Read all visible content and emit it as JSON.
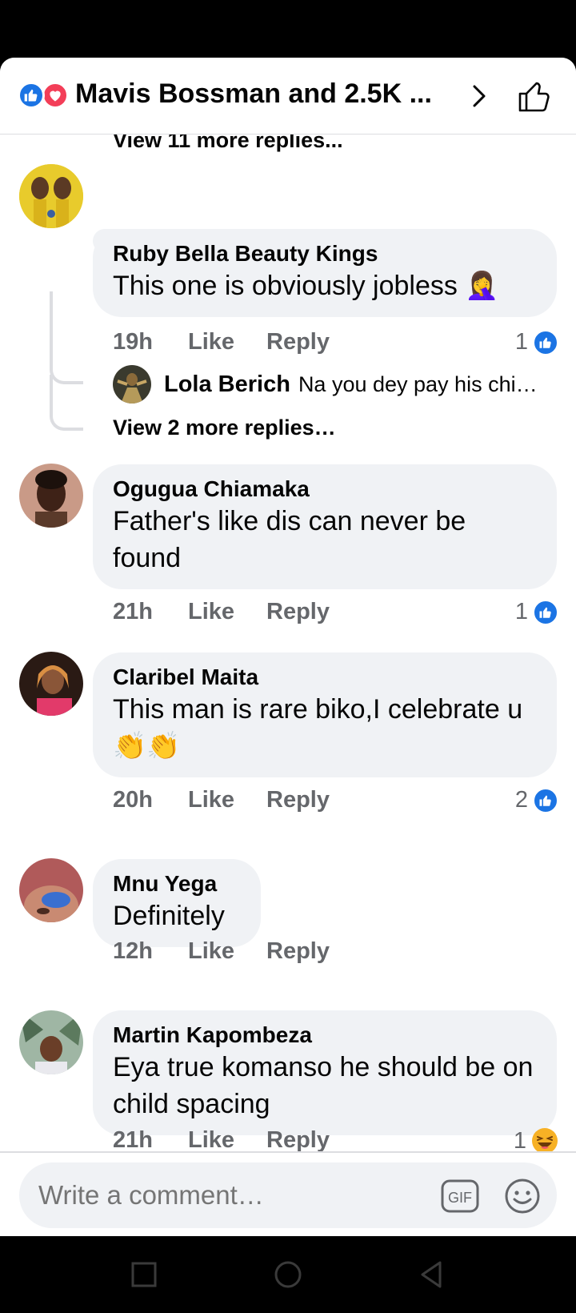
{
  "header": {
    "title": "Mavis Bossman and 2.5K ...",
    "colors": {
      "like": "#1b74e4",
      "love": "#f33e58"
    }
  },
  "cut_off_text": "View 11 more replies...",
  "comments": [
    {
      "author": "Ruby Bella Beauty Kings",
      "text": "This one is obviously jobless 🤦‍♀️",
      "time": "19h",
      "like": "Like",
      "reply": "Reply",
      "reaction_count": "1",
      "reaction_icon": "like-icon"
    },
    {
      "author": "Ogugua Chiamaka",
      "text": "Father's like dis can never be found",
      "time": "21h",
      "like": "Like",
      "reply": "Reply",
      "reaction_count": "1",
      "reaction_icon": "like-icon"
    },
    {
      "author": "Claribel Maita",
      "text": "This man is rare biko,I celebrate u👏👏",
      "time": "20h",
      "like": "Like",
      "reply": "Reply",
      "reaction_count": "2",
      "reaction_icon": "like-icon"
    },
    {
      "author": "Mnu Yega",
      "text": "Definitely",
      "time": "12h",
      "like": "Like",
      "reply": "Reply",
      "reaction_count": "",
      "reaction_icon": ""
    },
    {
      "author": "Martin Kapombeza",
      "text": "Eya true komanso he should be on child spacing",
      "time": "21h",
      "like": "Like",
      "reply": "Reply",
      "reaction_count": "1",
      "reaction_icon": "haha-icon"
    }
  ],
  "reply_preview": {
    "author": "Lola Berich",
    "text": "Na you dey pay his chi…"
  },
  "view_more_replies": "View 2 more replies…",
  "composer": {
    "placeholder": "Write a comment…",
    "gif_label": "GIF"
  }
}
